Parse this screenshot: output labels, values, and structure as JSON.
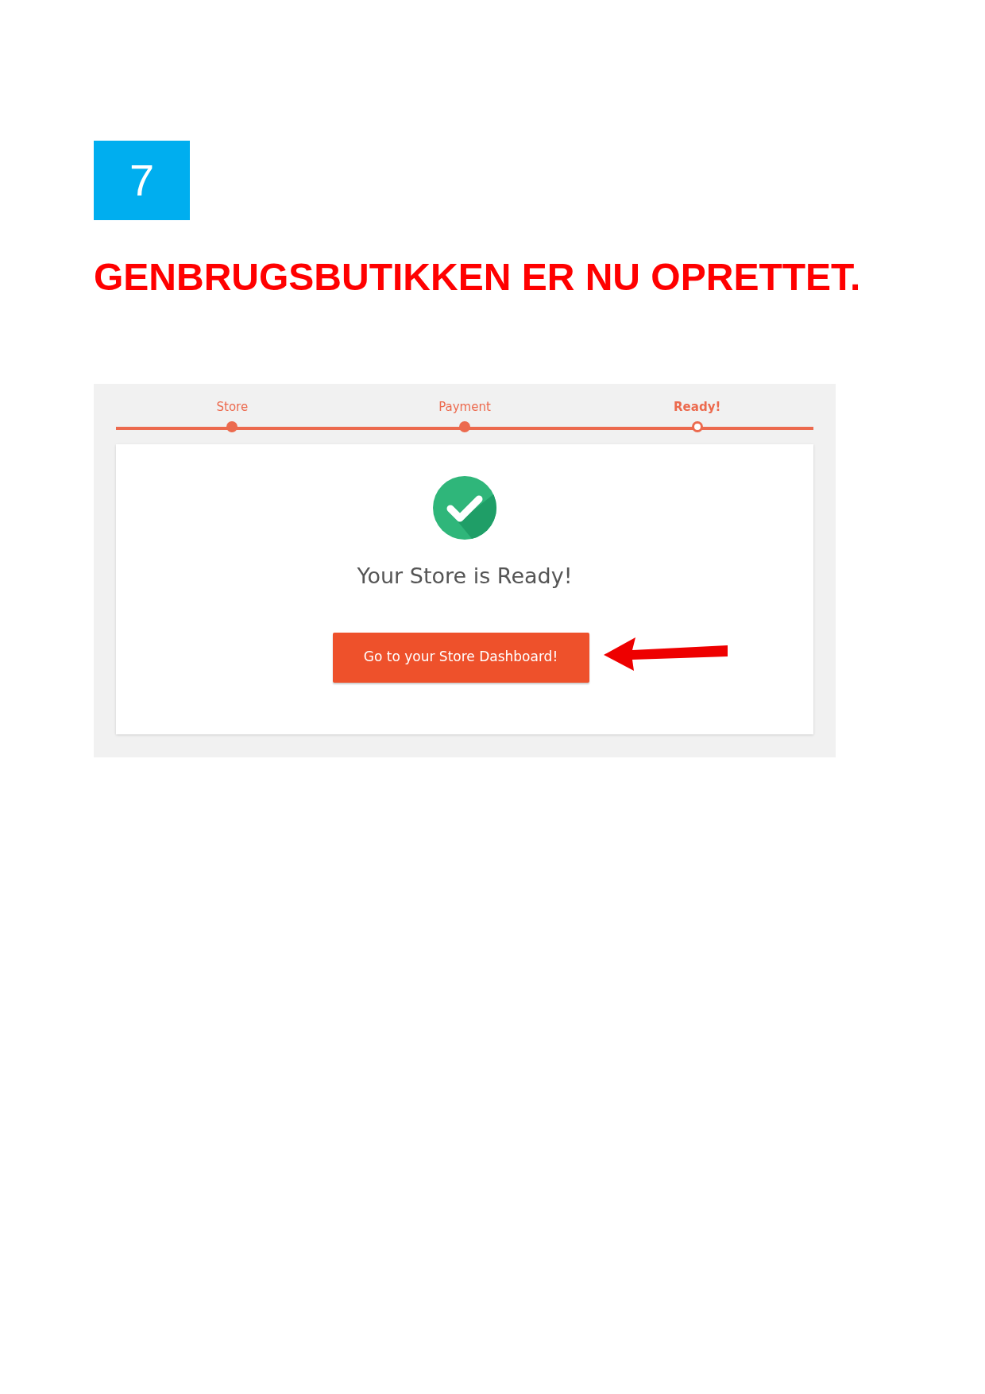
{
  "step_badge": "7",
  "heading": "GENBRUGSBUTIKKEN ER NU OPRETTET.",
  "wizard": {
    "steps": [
      {
        "label": "Store",
        "selected": false
      },
      {
        "label": "Payment",
        "selected": false
      },
      {
        "label": "Ready!",
        "selected": true
      }
    ],
    "title": "Your Store is Ready!",
    "button": "Go to your Store Dashboard!"
  }
}
